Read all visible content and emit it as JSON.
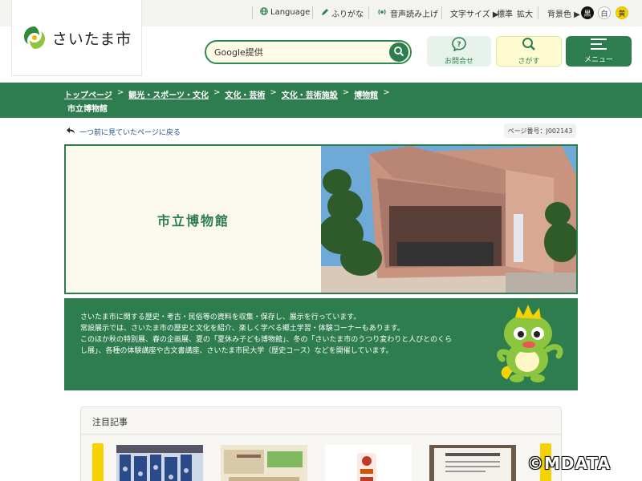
{
  "header": {
    "logo_text": "さいたま市",
    "util": {
      "language": "Language",
      "furigana": "ふりがな",
      "voice": "音声読み上げ",
      "font_size_label": "文字サイズ ▶",
      "font_standard": "標準",
      "font_large": "拡大",
      "bg_label": "背景色 ▶",
      "bg_black": "黒",
      "bg_white": "白",
      "bg_yellow": "黄"
    },
    "search": {
      "placeholder": "Google提供"
    },
    "buttons": {
      "contact": "お問合せ",
      "search": "さがす",
      "menu": "メニュー"
    }
  },
  "breadcrumb": {
    "items": [
      "トップページ",
      "観光・スポーツ・文化",
      "文化・芸術",
      "文化・芸術施設",
      "博物館"
    ],
    "separator": ">",
    "current": "市立博物館"
  },
  "content": {
    "back_link": "一つ前に見ていたページに戻る",
    "page_number": "ページ番号：J002143",
    "hero_title": "市立博物館",
    "intro": [
      "さいたま市に関する歴史・考古・民俗等の資料を収集・保存し、展示を行っています。",
      "常設展示では、さいたま市の歴史と文化を紹介、楽しく学べる郷土学習・体験コーナーもあります。",
      "このほか秋の特別展、春の企画展、夏の「夏休み子ども博物館」、冬の「さいたま市のうつり変わりと人びとのくら",
      "し展」、各種の体験講座や古文書講座、さいたま市民大学（歴史コース）などを開催しています。"
    ],
    "featured_title": "注目記事"
  },
  "watermark": "©MDATA",
  "colors": {
    "brand_green": "#2e7d4f",
    "accent_yellow": "#f5d200",
    "hero_bg": "#fbf9ee"
  }
}
